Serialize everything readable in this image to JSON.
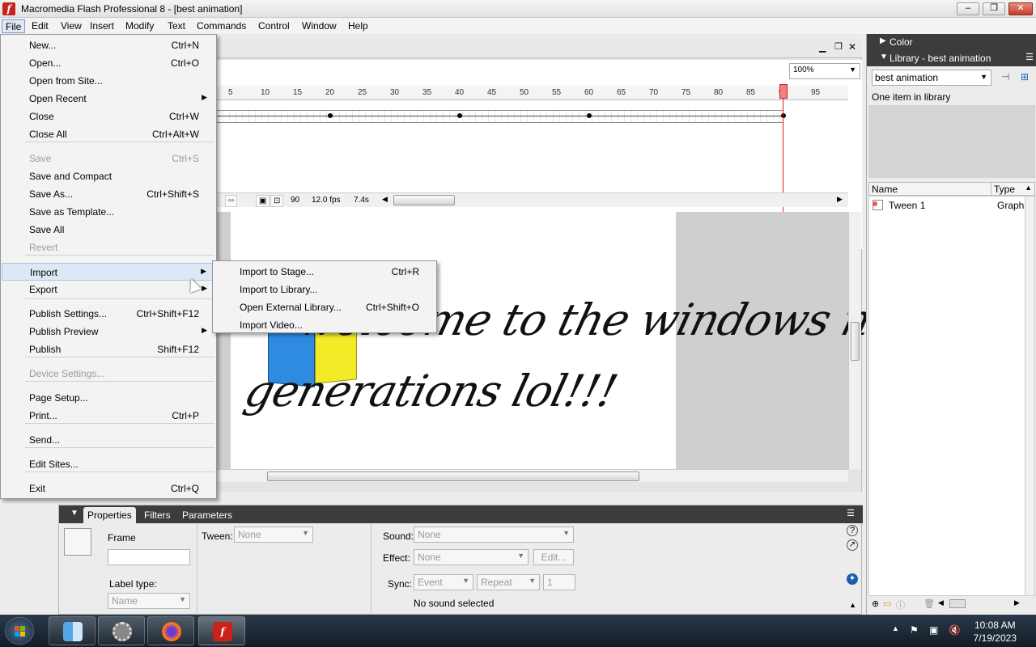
{
  "window": {
    "title": "Macromedia Flash Professional 8 - [best animation]",
    "app_icon": "flash-icon",
    "controls": [
      "minimize",
      "restore",
      "close"
    ]
  },
  "menubar": [
    "File",
    "Edit",
    "View",
    "Insert",
    "Modify",
    "Text",
    "Commands",
    "Control",
    "Window",
    "Help"
  ],
  "file_menu": {
    "items": [
      {
        "label": "New...",
        "shortcut": "Ctrl+N"
      },
      {
        "label": "Open...",
        "shortcut": "Ctrl+O"
      },
      {
        "label": "Open from Site...",
        "shortcut": ""
      },
      {
        "label": "Open Recent",
        "shortcut": "",
        "submenu": true
      },
      {
        "label": "Close",
        "shortcut": "Ctrl+W"
      },
      {
        "label": "Close All",
        "shortcut": "Ctrl+Alt+W"
      },
      {
        "label": "Save",
        "shortcut": "Ctrl+S",
        "disabled": true
      },
      {
        "label": "Save and Compact",
        "shortcut": ""
      },
      {
        "label": "Save As...",
        "shortcut": "Ctrl+Shift+S"
      },
      {
        "label": "Save as Template...",
        "shortcut": ""
      },
      {
        "label": "Save All",
        "shortcut": ""
      },
      {
        "label": "Revert",
        "shortcut": "",
        "disabled": true
      },
      {
        "label": "Import",
        "shortcut": "",
        "submenu": true,
        "highlighted": true
      },
      {
        "label": "Export",
        "shortcut": "",
        "submenu": true
      },
      {
        "label": "Publish Settings...",
        "shortcut": "Ctrl+Shift+F12"
      },
      {
        "label": "Publish Preview",
        "shortcut": "",
        "submenu": true
      },
      {
        "label": "Publish",
        "shortcut": "Shift+F12"
      },
      {
        "label": "Device Settings...",
        "shortcut": "",
        "disabled": true
      },
      {
        "label": "Page Setup...",
        "shortcut": ""
      },
      {
        "label": "Print...",
        "shortcut": "Ctrl+P"
      },
      {
        "label": "Send...",
        "shortcut": ""
      },
      {
        "label": "Edit Sites...",
        "shortcut": ""
      },
      {
        "label": "Exit",
        "shortcut": "Ctrl+Q"
      }
    ]
  },
  "import_submenu": [
    {
      "label": "Import to Stage...",
      "shortcut": "Ctrl+R"
    },
    {
      "label": "Import to Library...",
      "shortcut": ""
    },
    {
      "label": "Open External Library...",
      "shortcut": "Ctrl+Shift+O"
    },
    {
      "label": "Import Video...",
      "shortcut": ""
    }
  ],
  "timeline": {
    "ruler_ticks": [
      "5",
      "10",
      "15",
      "20",
      "25",
      "30",
      "35",
      "40",
      "45",
      "50",
      "55",
      "60",
      "65",
      "70",
      "75",
      "80",
      "85",
      "90",
      "95"
    ],
    "current_frame": "90",
    "fps": "12.0 fps",
    "elapsed": "7.4s",
    "zoom": "100%"
  },
  "stage": {
    "line1": "welcome to the windows next",
    "line2": "generations lol!!!"
  },
  "properties": {
    "tabs": [
      "Properties",
      "Filters",
      "Parameters"
    ],
    "frame_label": "Frame",
    "label_type_label": "Label type:",
    "label_type_value": "Name",
    "tween_label": "Tween:",
    "tween_value": "None",
    "sound_label": "Sound:",
    "sound_value": "None",
    "effect_label": "Effect:",
    "effect_value": "None",
    "edit_button": "Edit...",
    "sync_label": "Sync:",
    "sync_value": "Event",
    "repeat_value": "Repeat",
    "repeat_count": "1",
    "no_sound": "No sound selected"
  },
  "right_panel": {
    "color_title": "Color",
    "library_title": "Library - best animation",
    "library_select": "best animation",
    "library_count": "One item in library",
    "col_name": "Name",
    "col_type": "Type",
    "item_name": "Tween 1",
    "item_type": "Graph"
  },
  "taskbar": {
    "time": "10:08 AM",
    "date": "7/19/2023",
    "apps": [
      "start-orb",
      "finder-icon",
      "settings-icon",
      "firefox-icon",
      "flash-icon"
    ]
  },
  "colors": {
    "menu_highlight": "#dce8f5",
    "panel_header": "#3c3c3c",
    "playhead": "#d22222",
    "flash_red": "#c9221a"
  }
}
